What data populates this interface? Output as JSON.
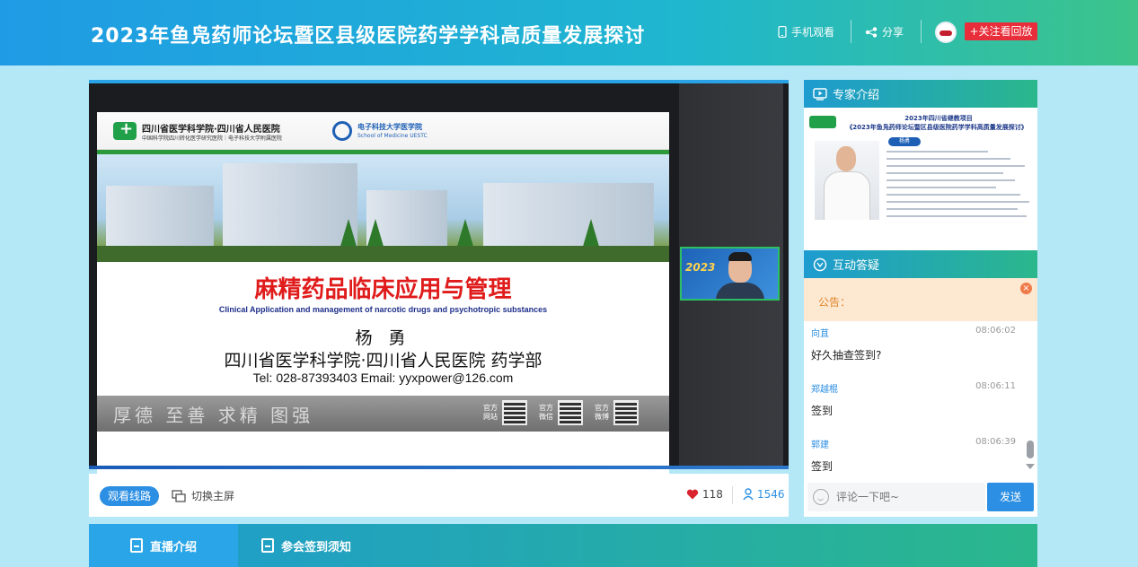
{
  "header": {
    "title": "2023年鱼凫药师论坛暨区县级医院药学学科高质量发展探讨",
    "mobile_label": "手机观看",
    "share_label": "分享",
    "follow_label": "+关注看回放"
  },
  "slide": {
    "logo1_text": "四川省医学科学院·四川省人民医院",
    "logo1_sub": "中国科学院四川转化医学研究医院｜电子科技大学附属医院",
    "logo2_text": "电子科技大学医学院",
    "logo2_sub": "School of Medicine UESTC",
    "title": "麻精药品临床应用与管理",
    "subtitle_en": "Clinical Application and management of narcotic drugs and psychotropic substances",
    "speaker": "杨 勇",
    "institution": "四川省医学科学院·四川省人民医院 药学部",
    "contact": "Tel: 028-87393403 Email: yyxpower@126.com",
    "motto": "厚德 至善 求精 图强",
    "qr_labels": [
      "官方网站",
      "官方微信",
      "官方微博"
    ]
  },
  "camera": {
    "overlay_text": "2023"
  },
  "controls": {
    "route_label": "观看线路",
    "switch_label": "切换主屏",
    "likes": "118",
    "viewers": "1546"
  },
  "expert": {
    "heading": "专家介绍",
    "card_title1": "2023年四川省继教项目",
    "card_title2": "《2023年鱼凫药师论坛暨区县级医院药学学科高质量发展探讨》",
    "badge": "杨勇"
  },
  "qa": {
    "heading": "互动答疑",
    "notice_label": "公告：",
    "messages": [
      {
        "user": "向苴",
        "time": "08:06:02",
        "text": "好久抽查签到?"
      },
      {
        "user": "郑越棍",
        "time": "08:06:11",
        "text": "签到"
      },
      {
        "user": "郭建",
        "time": "08:06:39",
        "text": "签到"
      }
    ],
    "comment_placeholder": "评论一下吧~",
    "send_label": "发送"
  },
  "tabs": [
    {
      "label": "直播介绍"
    },
    {
      "label": "参会签到须知"
    }
  ],
  "colors": {
    "accent": "#2c8fe3",
    "follow_red": "#e82e3a",
    "slide_title_red": "#e01b1b"
  }
}
